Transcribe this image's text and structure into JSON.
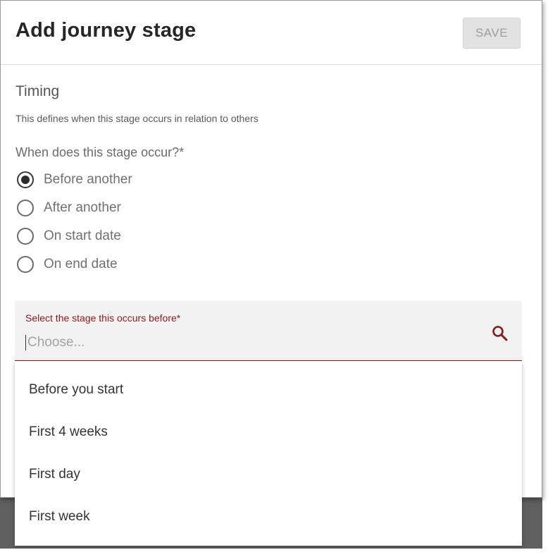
{
  "dialog": {
    "title": "Add journey stage",
    "save_label": "SAVE"
  },
  "timing": {
    "title": "Timing",
    "description": "This defines when this stage occurs in relation to others",
    "question": "When does this stage occur?*",
    "options": [
      {
        "label": "Before another",
        "checked": true
      },
      {
        "label": "After another",
        "checked": false
      },
      {
        "label": "On start date",
        "checked": false
      },
      {
        "label": "On end date",
        "checked": false
      }
    ]
  },
  "stage_select": {
    "label": "Select the stage this occurs before*",
    "placeholder": "Choose...",
    "icon": "search-icon",
    "accent_color": "#8b1a1a",
    "options": [
      "Before you start",
      "First 4 weeks",
      "First day",
      "First week"
    ]
  }
}
